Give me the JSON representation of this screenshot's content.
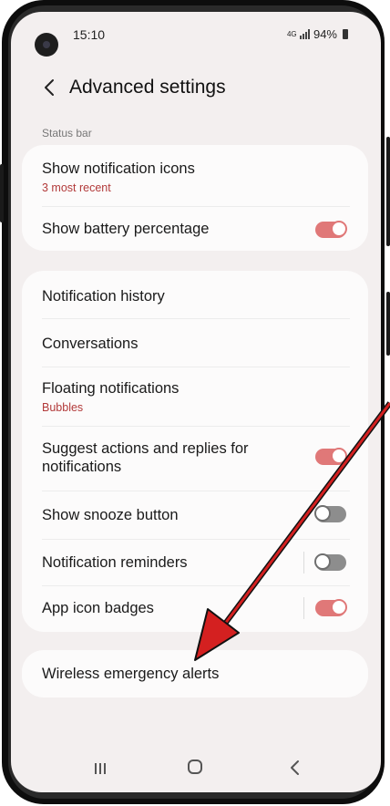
{
  "status_bar": {
    "time": "15:10",
    "network": "4G",
    "battery": "94%"
  },
  "header": {
    "title": "Advanced settings"
  },
  "section_status_bar": {
    "label": "Status bar",
    "items": [
      {
        "label": "Show notification icons",
        "sub": "3 most recent"
      },
      {
        "label": "Show battery percentage",
        "toggle": true
      }
    ]
  },
  "notifications_card": {
    "items": [
      {
        "label": "Notification history"
      },
      {
        "label": "Conversations"
      },
      {
        "label": "Floating notifications",
        "sub": "Bubbles"
      },
      {
        "label": "Suggest actions and replies for notifications",
        "toggle": true
      },
      {
        "label": "Show snooze button",
        "toggle": false
      },
      {
        "label": "Notification reminders",
        "toggle": false
      },
      {
        "label": "App icon badges",
        "toggle": true
      }
    ]
  },
  "emergency_card": {
    "label": "Wireless emergency alerts"
  },
  "colors": {
    "toggle_on": "#e07878",
    "toggle_off": "#8d8d8d",
    "subtext": "#b23a3a",
    "annotation_arrow": "#d42020"
  },
  "icons": {
    "back": "chevron-left-icon",
    "nav_recents": "recents-icon",
    "nav_home": "home-icon",
    "nav_back": "back-icon"
  }
}
